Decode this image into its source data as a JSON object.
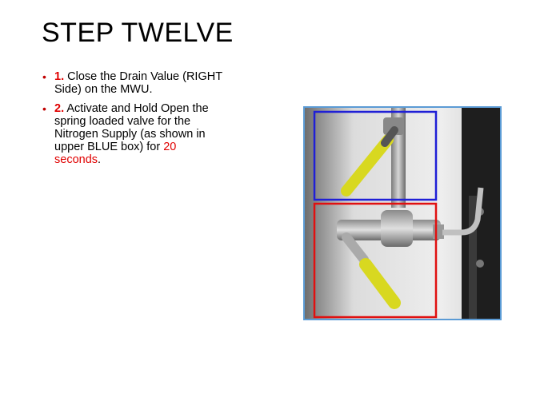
{
  "slide": {
    "title": "STEP TWELVE",
    "bullets": [
      {
        "number": "1.",
        "text_before": " Close the Drain Value (RIGHT Side) on the MWU.",
        "highlight": "",
        "text_after": ""
      },
      {
        "number": "2.",
        "text_before": " Activate and Hold Open the spring loaded valve for the Nitrogen Supply (as shown in upper BLUE box) for ",
        "highlight": "20 seconds",
        "text_after": "."
      }
    ]
  },
  "photo": {
    "frame_color": "#5b9bd5",
    "blue_box_color": "#1f1fd6",
    "red_box_color": "#e01010",
    "handle_color": "#d8d820"
  }
}
